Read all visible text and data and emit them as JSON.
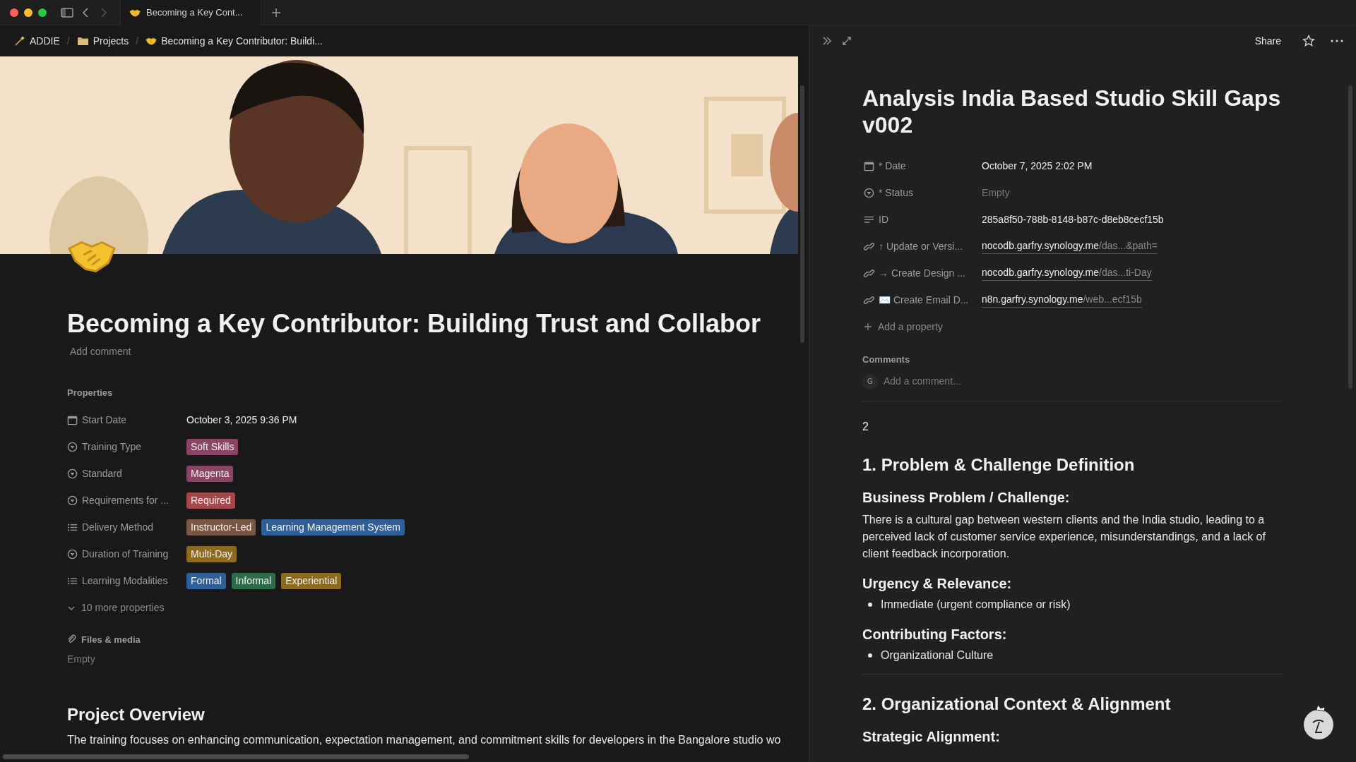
{
  "browser_tab": {
    "title": "Becoming a Key Cont..."
  },
  "breadcrumb": [
    {
      "kind": "workspace",
      "label": "ADDIE"
    },
    {
      "kind": "folder",
      "separator": "/",
      "label": "Projects"
    },
    {
      "kind": "page",
      "separator": "/",
      "label": "Becoming a Key Contributor: Buildi..."
    }
  ],
  "page": {
    "kind": "picture",
    "title": "Becoming a Key Contributor: Building Trust and Collabor",
    "add_comment": "Add comment",
    "properties_heading": "Properties",
    "properties": [
      {
        "kind": "date",
        "label": "Start Date",
        "value": "October 3, 2025 9:36 PM"
      },
      {
        "kind": "select",
        "label": "Training Type",
        "tags": [
          {
            "text": "Soft Skills",
            "color": "#8a4566"
          }
        ]
      },
      {
        "kind": "select",
        "label": "Standard",
        "tags": [
          {
            "text": "Magenta",
            "color": "#8a4566"
          }
        ]
      },
      {
        "kind": "select",
        "label": "Requirements for ...",
        "tags": [
          {
            "text": "Required",
            "color": "#a3474b"
          }
        ]
      },
      {
        "kind": "multiselect",
        "label": "Delivery Method",
        "tags": [
          {
            "text": "Instructor-Led",
            "color": "#7a5743"
          },
          {
            "text": "Learning Management System",
            "color": "#2f5f96"
          }
        ]
      },
      {
        "kind": "select",
        "label": "Duration of Training",
        "tags": [
          {
            "text": "Multi-Day",
            "color": "#8c6a1f"
          }
        ]
      },
      {
        "kind": "multiselect",
        "label": "Learning Modalities",
        "tags": [
          {
            "text": "Formal",
            "color": "#2f5f96"
          },
          {
            "text": "Informal",
            "color": "#2e6b4b"
          },
          {
            "text": "Experiential",
            "color": "#8c6a1f"
          }
        ]
      }
    ],
    "more_properties": {
      "label": "10 more properties",
      "expanded": false
    },
    "files": {
      "label": "Files & media",
      "value": "Empty"
    },
    "section_heading": "Project Overview",
    "section_text": "The training focuses on enhancing communication, expectation management, and commitment skills for developers in the Bangalore studio wo"
  },
  "side_peek": {
    "share": "Share",
    "title": "Analysis India Based Studio Skill Gaps v002",
    "properties": [
      {
        "kind": "date",
        "label": "* Date",
        "value": "October 7, 2025 2:02 PM"
      },
      {
        "kind": "status",
        "label": "* Status",
        "value": "Empty"
      },
      {
        "kind": "text",
        "label": "ID",
        "value": "285a8f50-788b-8148-b87c-d8eb8cecf15b"
      },
      {
        "kind": "url",
        "label": "↑ Update or Versi...",
        "host": "nocodb.garfry.synology.me",
        "path": "/das...&path="
      },
      {
        "kind": "url",
        "label": "→ Create Design ...",
        "host": "nocodb.garfry.synology.me",
        "path": "/das...ti-Day"
      },
      {
        "kind": "url",
        "label": "✉️ Create Email D...",
        "host": "n8n.garfry.synology.me",
        "path": "/web...ecf15b"
      }
    ],
    "add_property": "Add a property",
    "comments_heading": "Comments",
    "comment_avatar": "G",
    "comment_placeholder": "Add a comment...",
    "blocks": [
      {
        "kind": "paragraph",
        "text": "2"
      },
      {
        "kind": "h2",
        "text": "1. Problem & Challenge Definition"
      },
      {
        "kind": "h3",
        "text": "Business Problem / Challenge:"
      },
      {
        "kind": "paragraph",
        "text": "There is a cultural gap between western clients and the India studio, leading to a perceived lack of customer service experience, misunderstandings, and a lack of client feedback incorporation."
      },
      {
        "kind": "h3",
        "text": "Urgency & Relevance:"
      },
      {
        "kind": "bullet",
        "text": "Immediate (urgent compliance or risk)"
      },
      {
        "kind": "h3",
        "text": "Contributing Factors:"
      },
      {
        "kind": "bullet",
        "text": "Organizational Culture"
      },
      {
        "kind": "divider"
      },
      {
        "kind": "h2",
        "text": "2. Organizational Context & Alignment"
      },
      {
        "kind": "h3",
        "text": "Strategic Alignment:"
      }
    ]
  }
}
